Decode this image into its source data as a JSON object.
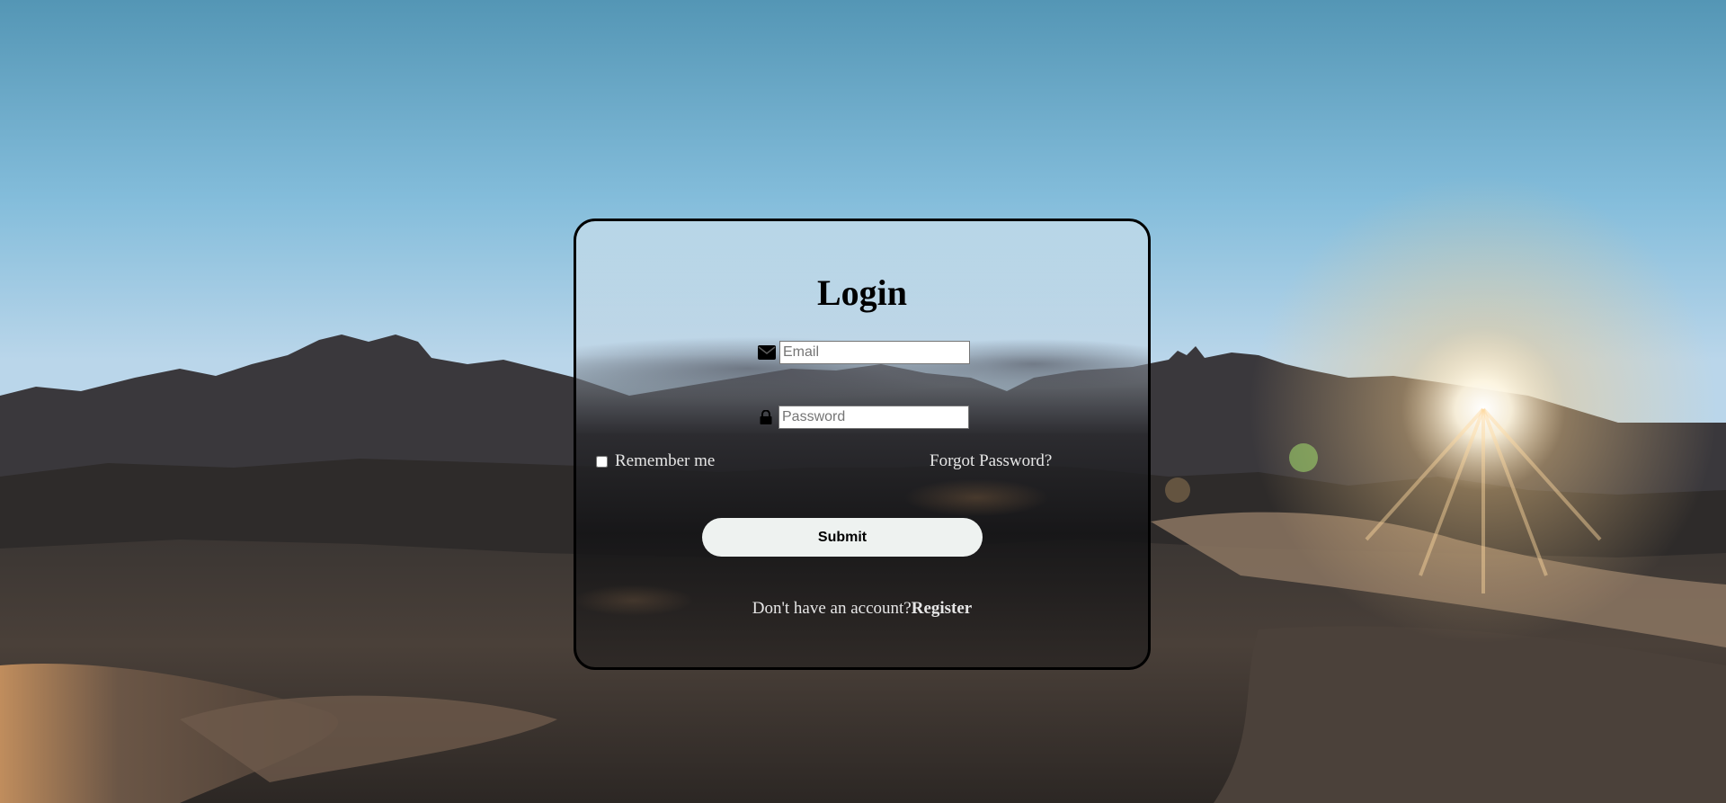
{
  "page": {
    "title": "Login"
  },
  "form": {
    "email": {
      "icon": "envelope-icon",
      "placeholder": "Email",
      "value": ""
    },
    "password": {
      "icon": "lock-icon",
      "placeholder": "Password",
      "value": ""
    },
    "remember_label": "Remember me",
    "remember_checked": false,
    "forgot_label": "Forgot Password?",
    "submit_label": "Submit",
    "register_prompt": "Don't have an account?",
    "register_label": "Register"
  },
  "colors": {
    "card_border": "#000000",
    "button_bg": "#eef2f0",
    "link_text": "#e6e6e6"
  }
}
